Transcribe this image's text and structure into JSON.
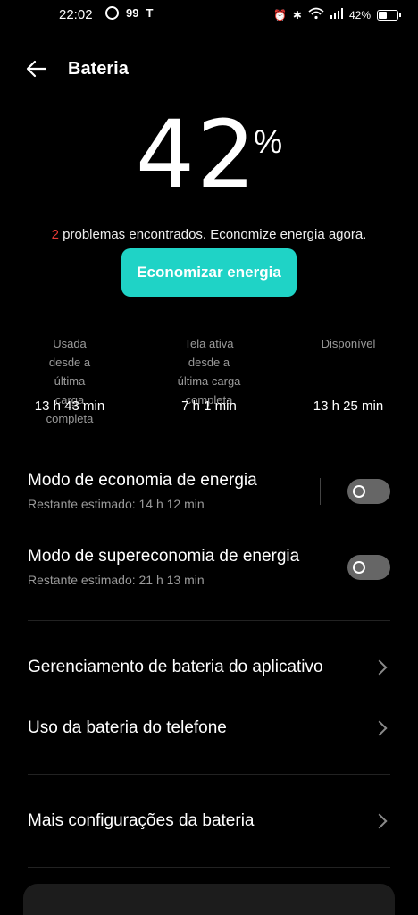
{
  "status_bar": {
    "time": "22:02",
    "notif_count": "99",
    "battery_percent": "42%",
    "battery_level": 0.42
  },
  "header": {
    "title": "Bateria"
  },
  "battery": {
    "percent_value": "42",
    "percent_symbol": "%",
    "problems_count": "2",
    "problems_text": " problemas encontrados. Economize energia agora.",
    "save_button": "Economizar energia"
  },
  "stats": [
    {
      "label": "Usada desde a última carga completa",
      "value": "13 h 43 min"
    },
    {
      "label": "Tela ativa desde a última carga completa",
      "value": "7 h 1 min"
    },
    {
      "label": "Disponível",
      "value": "13 h 25 min"
    }
  ],
  "modes": {
    "power_saving": {
      "title": "Modo de economia de energia",
      "subtitle": "Restante estimado:  14 h 12 min",
      "enabled": false
    },
    "super_saving": {
      "title": "Modo de supereconomia de energia",
      "subtitle": "Restante estimado:  21 h 13 min",
      "enabled": false
    }
  },
  "menu": {
    "app_management": "Gerenciamento de bateria do aplicativo",
    "phone_usage": "Uso da bateria do telefone",
    "more_settings": "Mais configurações da bateria"
  }
}
